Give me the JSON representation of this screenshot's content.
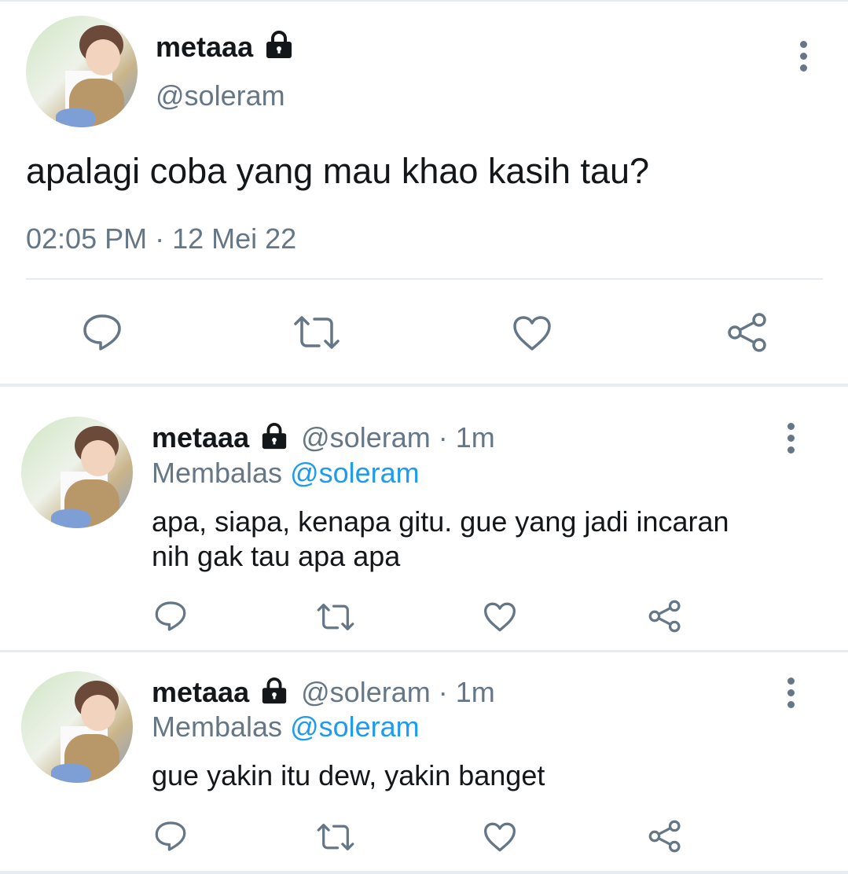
{
  "main_tweet": {
    "display_name": "metaaa",
    "handle": "@soleram",
    "text": "apalagi coba yang mau khao kasih tau?",
    "timestamp": "02:05 PM · 12 Mei 22",
    "lock_icon": "lock-icon",
    "actions": [
      "reply-icon",
      "retweet-icon",
      "like-icon",
      "share-icon"
    ]
  },
  "replies": [
    {
      "display_name": "metaaa",
      "handle": "@soleram",
      "time": "· 1m",
      "replying_prefix": "Membalas",
      "replying_to": "@soleram",
      "text_line1": "apa, siapa, kenapa gitu. gue yang jadi incaran",
      "text_line2": "nih gak tau apa apa"
    },
    {
      "display_name": "metaaa",
      "handle": "@soleram",
      "time": "· 1m",
      "replying_prefix": "Membalas",
      "replying_to": "@soleram",
      "text_line1": "gue yakin itu dew, yakin banget"
    }
  ],
  "colors": {
    "text": "#14171a",
    "secondary": "#657786",
    "link": "#1d9bf0",
    "divider": "#e6ecf0"
  }
}
